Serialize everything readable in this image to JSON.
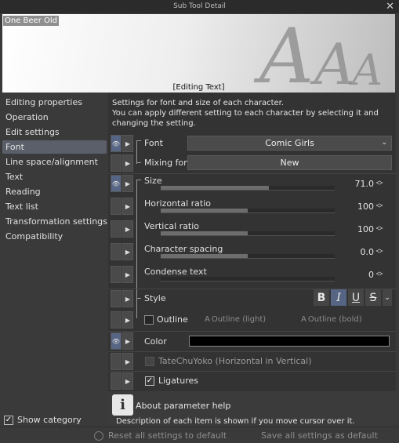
{
  "window": {
    "title": "Sub Tool Detail",
    "close_glyph": "✕"
  },
  "preview": {
    "font_name": "One Beer Old",
    "caption": "[Editing Text]",
    "deco_letters": [
      "A",
      "A",
      "A"
    ]
  },
  "sidebar": {
    "items": [
      {
        "label": "Editing properties",
        "selected": false
      },
      {
        "label": "Operation",
        "selected": false
      },
      {
        "label": "Edit settings",
        "selected": false
      },
      {
        "label": "Font",
        "selected": true
      },
      {
        "label": "Line space/alignment",
        "selected": false
      },
      {
        "label": "Text",
        "selected": false
      },
      {
        "label": "Reading",
        "selected": false
      },
      {
        "label": "Text list",
        "selected": false
      },
      {
        "label": "Transformation settings",
        "selected": false
      },
      {
        "label": "Compatibility",
        "selected": false
      }
    ],
    "show_category_label": "Show category",
    "show_category_checked": true
  },
  "panel": {
    "description_line1": "Settings for font and size of each character.",
    "description_line2": "You can apply different setting to each character by selecting it and",
    "description_line3": "changing the setting.",
    "font_label": "Font",
    "font_value": "Comic Girls",
    "mixing_font_label": "Mixing font",
    "mixing_font_button": "New",
    "size_label": "Size",
    "size_value": "71.0",
    "size_fill": 0.62,
    "horizontal_ratio_label": "Horizontal ratio",
    "horizontal_ratio_value": "100",
    "horizontal_ratio_fill": 0.5,
    "vertical_ratio_label": "Vertical ratio",
    "vertical_ratio_value": "100",
    "vertical_ratio_fill": 0.5,
    "char_spacing_label": "Character spacing",
    "char_spacing_value": "0.0",
    "char_spacing_fill": 0.5,
    "condense_label": "Condense text",
    "condense_value": "0",
    "condense_fill": 0.0,
    "style_label": "Style",
    "style_buttons": {
      "bold": "B",
      "italic": "I",
      "underline": "U",
      "strike": "S"
    },
    "outline_label": "Outline",
    "outline_light": "Outline (light)",
    "outline_bold": "Outline (bold)",
    "color_label": "Color",
    "color_value": "#000000",
    "tatechuyoko_label": "TateChuYoko (Horizontal in Vertical)",
    "ligatures_label": "Ligatures",
    "ligatures_checked": true
  },
  "help": {
    "icon": "i",
    "title": "About parameter help",
    "description": "Description of each item is shown if you move cursor over it."
  },
  "footer": {
    "reset_label": "Reset all settings to default",
    "save_label": "Save all settings as default"
  }
}
